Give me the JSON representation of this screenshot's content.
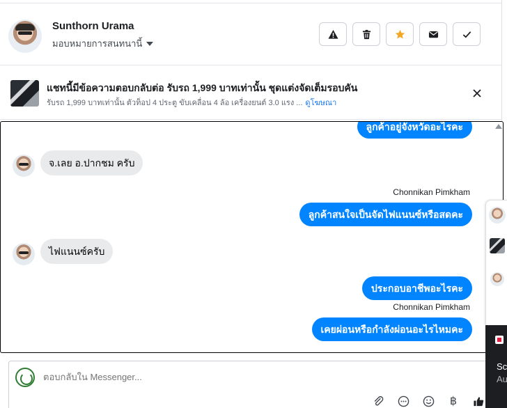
{
  "header": {
    "contact_name": "Sunthorn Urama",
    "assign_label": "มอบหมายการสนทนานี้",
    "actions": [
      {
        "name": "report-button",
        "icon": "warning-icon"
      },
      {
        "name": "delete-button",
        "icon": "trash-icon"
      },
      {
        "name": "star-button",
        "icon": "star-icon",
        "color": "#f5a623"
      },
      {
        "name": "mark-unread-button",
        "icon": "envelope-icon"
      },
      {
        "name": "mark-done-button",
        "icon": "check-icon"
      }
    ]
  },
  "ad": {
    "title": "แชทนี้มีข้อความตอบกลับต่อ รับรถ 1,999 บาทเท่านั้น ชุดแต่งจัดเต็มรอบคัน",
    "subtitle": "รับรถ 1,999 บาทเท่านั้น ตัวท็อป 4 ประตู ขับเคลื่อน 4 ล้อ เครื่องยนต์ 3.0 แรง ...",
    "link": "ดูโฆษณา"
  },
  "messages": [
    {
      "direction": "out",
      "text": "ลูกค้าอยู่จังหวัดอะไรคะ"
    },
    {
      "direction": "in",
      "text": "จ.เลย อ.ปากชม ครับ"
    },
    {
      "direction": "out",
      "sender": "Chonnikan Pimkham",
      "text": "ลูกค้าสนใจเป็นจัดไฟแนนซ์หรือสดคะ"
    },
    {
      "direction": "in",
      "text": "ไฟแนนซ์ครับ"
    },
    {
      "direction": "out",
      "text": "ประกอบอาชีพอะไรคะ"
    },
    {
      "direction": "out",
      "sender": "Chonnikan Pimkham",
      "text": "เคยผ่อนหรือกำลังผ่อนอะไรไหมคะ"
    }
  ],
  "composer": {
    "placeholder": "ตอบกลับใน Messenger...",
    "icons": [
      "paperclip-icon",
      "saved-replies-icon",
      "emoji-icon",
      "payment-icon",
      "thumbs-up-icon"
    ],
    "currency_symbol": "฿"
  },
  "side_panel": {
    "line1": "Sc",
    "line2": "Au"
  },
  "colors": {
    "outgoing_bubble": "#0084ff",
    "incoming_bubble": "#e9eaec",
    "link": "#1877f2",
    "star": "#f5a623"
  }
}
